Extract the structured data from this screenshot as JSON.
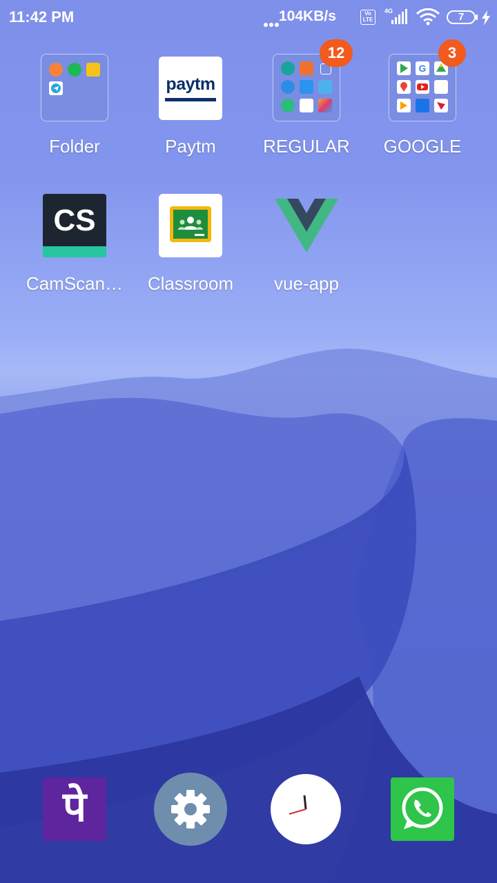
{
  "status_bar": {
    "time": "11:42 PM",
    "network_speed": "104KB/s",
    "volte_label": "Vo LTE",
    "network_type": "4G",
    "battery_level": "7"
  },
  "apps": [
    {
      "name": "Folder",
      "type": "folder"
    },
    {
      "name": "Paytm",
      "icon": "paytm-icon",
      "tile_text": "paytm"
    },
    {
      "name": "REGULAR",
      "type": "folder",
      "badge": "12"
    },
    {
      "name": "GOOGLE",
      "type": "folder",
      "badge": "3"
    },
    {
      "name": "CamScan…",
      "icon": "camscanner-icon",
      "tile_text": "CS"
    },
    {
      "name": "Classroom",
      "icon": "google-classroom-icon"
    },
    {
      "name": "vue-app",
      "icon": "vue-logo-icon"
    }
  ],
  "dock": [
    {
      "name": "PhonePe",
      "icon": "phonepe-icon",
      "glyph": "पे",
      "color": "#5f259f"
    },
    {
      "name": "Settings",
      "icon": "settings-gear-icon",
      "color": "#6f8eae"
    },
    {
      "name": "Clock",
      "icon": "clock-icon",
      "color": "#ffffff"
    },
    {
      "name": "WhatsApp",
      "icon": "whatsapp-icon",
      "color": "#2fc44a"
    }
  ],
  "colors": {
    "badge": "#f25a1e",
    "paytm_blue": "#0b2f6a",
    "paytm_light": "#00b9f1",
    "camscanner_green": "#25c6a0"
  }
}
